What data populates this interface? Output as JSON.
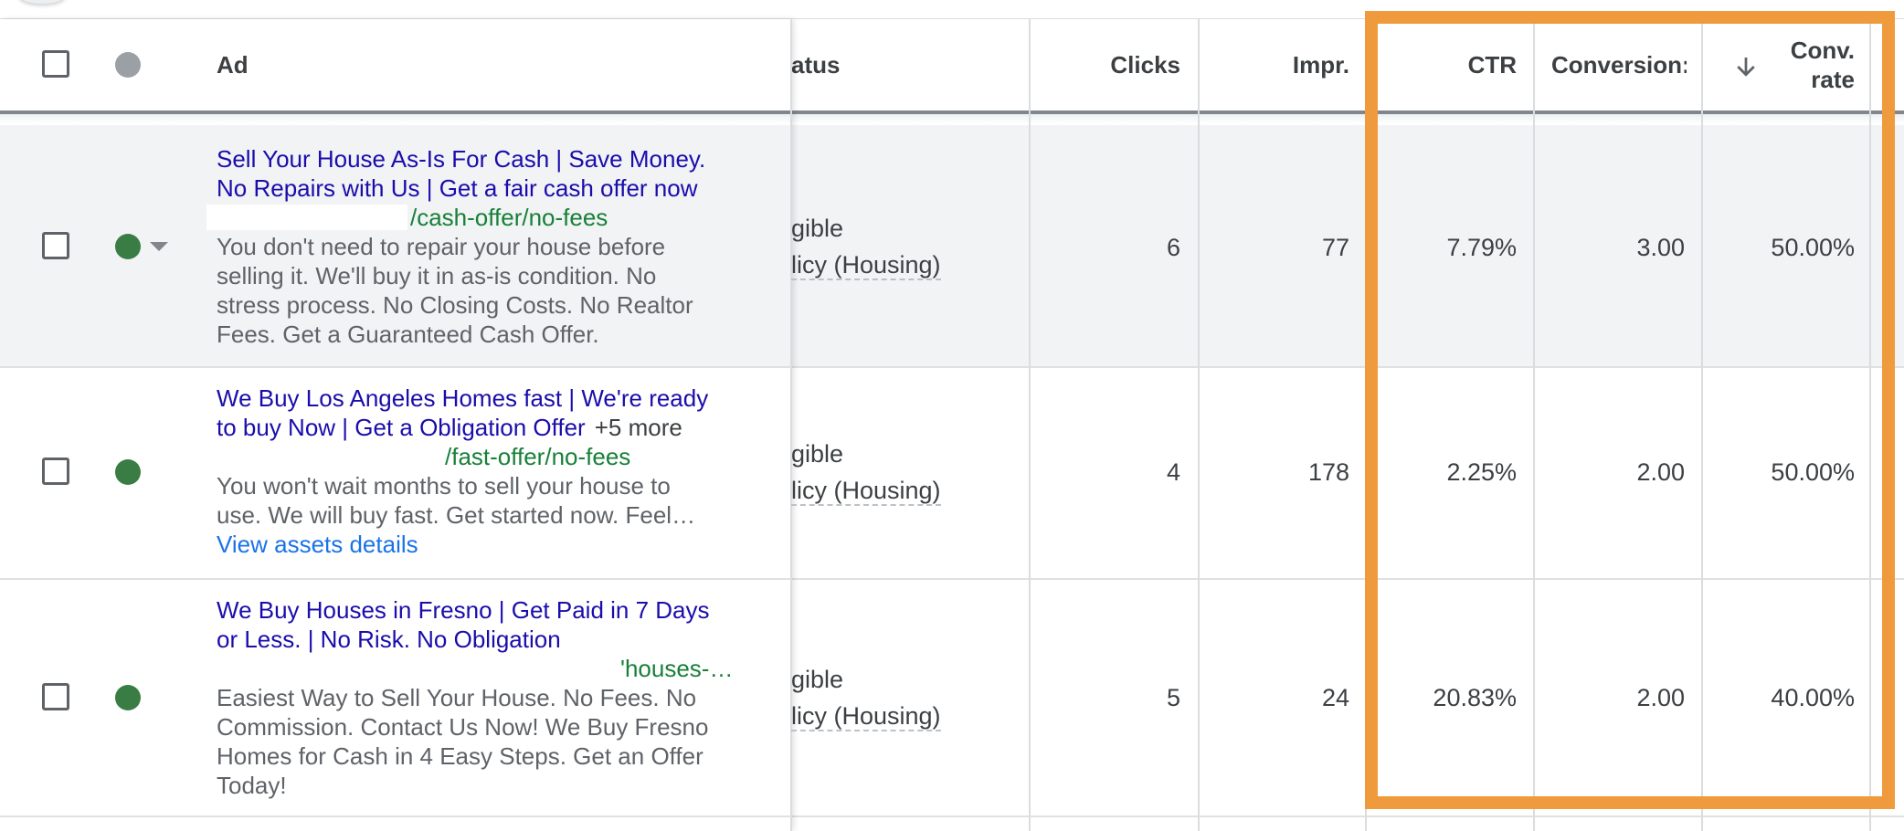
{
  "colors": {
    "highlight": "#f09a3e",
    "status_eligible": "#3a7d44",
    "status_header": "#9aa0a6",
    "headline": "#1a0dab",
    "url": "#188038",
    "link": "#1a73e8",
    "row_hover_bg": "#f1f3f4"
  },
  "header": {
    "ad": "Ad",
    "status_partial": "atus",
    "clicks": "Clicks",
    "impr": "Impr.",
    "ctr": "CTR",
    "conversions": "Conversion:",
    "conv_rate_line1": "Conv.",
    "conv_rate_line2": "rate",
    "sort_icon": "arrow-down-icon"
  },
  "rows": [
    {
      "headline1": "Sell Your House As-Is For Cash | Save Money.",
      "headline2": "No Repairs with Us | Get a fair cash offer now",
      "url": "/cash-offer/no-fees",
      "desc1": "You don't need to repair your house before",
      "desc2": "selling it. We'll buy it in as-is condition. No",
      "desc3": "stress process. No Closing Costs. No Realtor",
      "desc4": "Fees. Get a Guaranteed Cash Offer.",
      "status1": "gible",
      "status2": "licy (Housing)",
      "clicks": "6",
      "impr": "77",
      "ctr": "7.79%",
      "conversions": "3.00",
      "conv_rate": "50.00%"
    },
    {
      "headline1": "We Buy Los Angeles Homes fast | We're ready",
      "headline2": "to buy Now | Get a Obligation Offer",
      "more": "+5 more",
      "url": "/fast-offer/no-fees",
      "desc1": "You won't wait months to sell your house to",
      "desc2": "use. We will buy fast. Get started now. Feel…",
      "link": "View assets details",
      "status1": "gible",
      "status2": "licy (Housing)",
      "clicks": "4",
      "impr": "178",
      "ctr": "2.25%",
      "conversions": "2.00",
      "conv_rate": "50.00%"
    },
    {
      "headline1": "We Buy Houses in Fresno | Get Paid in 7 Days",
      "headline2": "or Less. | No Risk. No Obligation",
      "url": "'houses-…",
      "desc1": "Easiest Way to Sell Your House. No Fees. No",
      "desc2": "Commission. Contact Us Now! We Buy Fresno",
      "desc3": "Homes for Cash in 4 Easy Steps. Get an Offer",
      "desc4": "Today!",
      "status1": "gible",
      "status2": "licy (Housing)",
      "clicks": "5",
      "impr": "24",
      "ctr": "20.83%",
      "conversions": "2.00",
      "conv_rate": "40.00%"
    }
  ]
}
